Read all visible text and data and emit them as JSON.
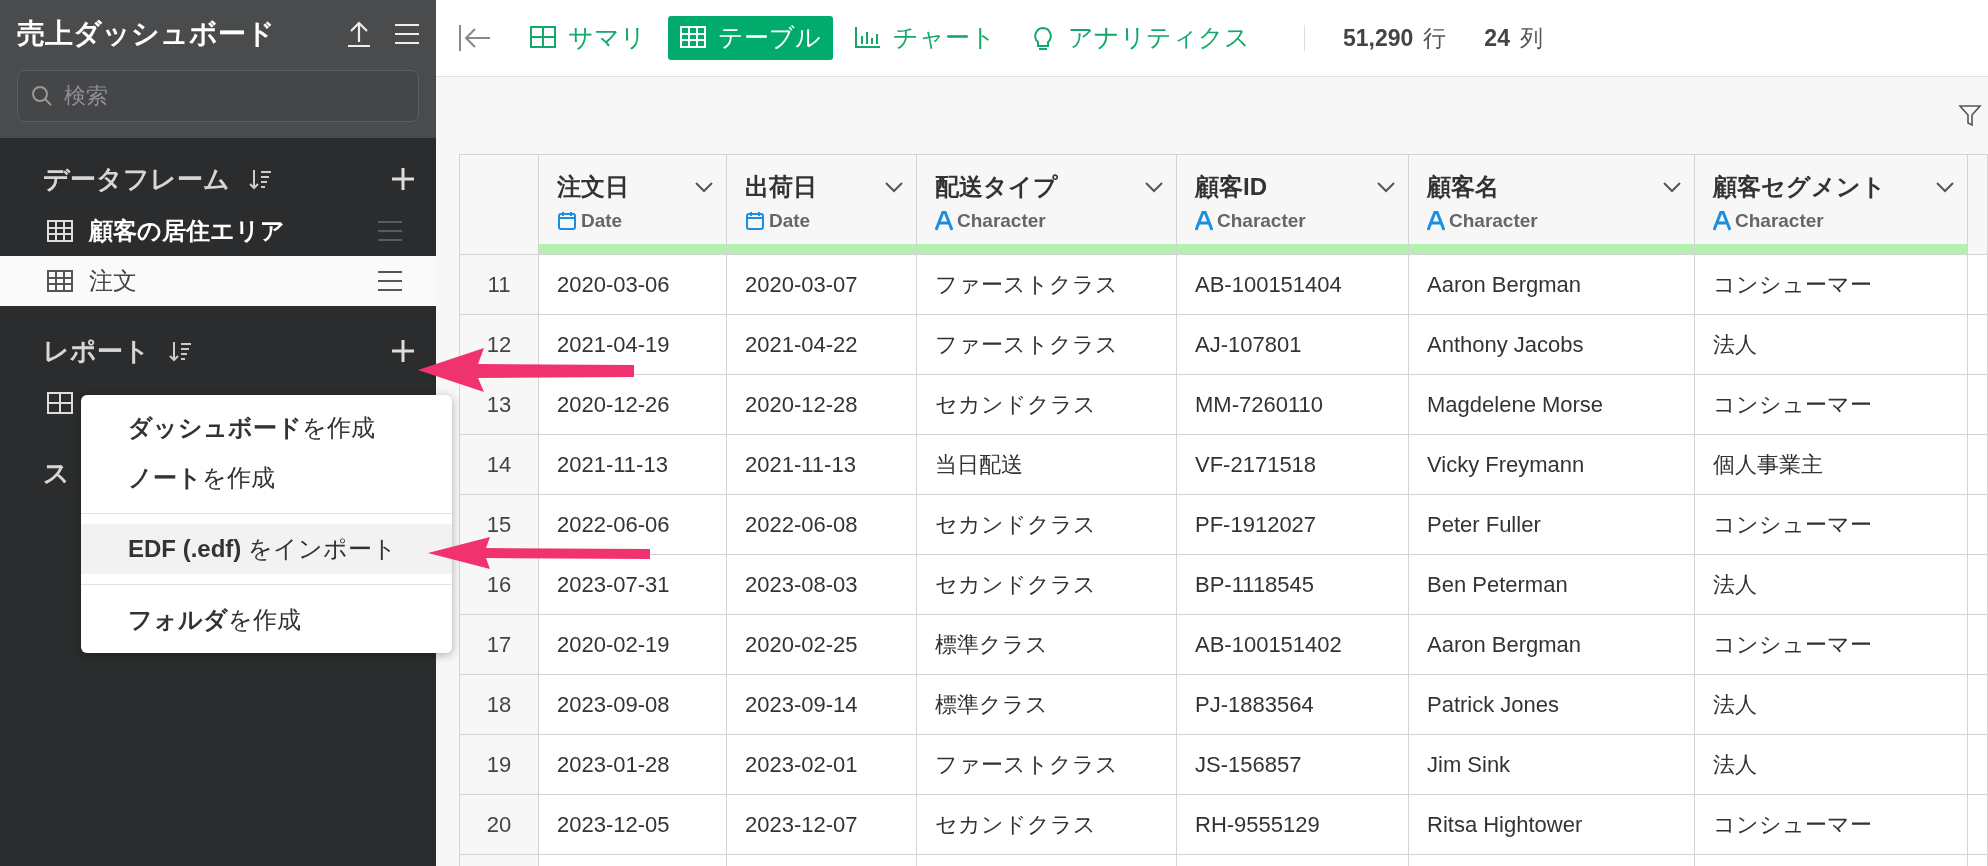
{
  "sidebar": {
    "title": "売上ダッシュボード",
    "search": {
      "placeholder": "検索"
    },
    "sections": [
      {
        "title": "データフレーム",
        "items": [
          {
            "label": "顧客の居住エリア",
            "selected": false
          },
          {
            "label": "注文",
            "selected": true
          }
        ]
      },
      {
        "title": "レポート",
        "items": [
          {
            "selected": false
          }
        ]
      },
      {
        "title": "ス"
      }
    ]
  },
  "menu": {
    "groups": [
      [
        {
          "label": "**ダッシュボード**を作成",
          "highlighted": false
        },
        {
          "label": "**ノート**を作成",
          "highlighted": false
        }
      ],
      [
        {
          "label": "**EDF (.edf)** をインポート",
          "highlighted": true
        }
      ],
      [
        {
          "label": "**フォルダ**を作成",
          "highlighted": false
        }
      ]
    ]
  },
  "toolbar": {
    "tabs": [
      {
        "kind": "summary",
        "label": "サマリ",
        "selected": false
      },
      {
        "kind": "table",
        "label": "テーブル",
        "selected": true
      },
      {
        "kind": "chart",
        "label": "チャート",
        "selected": false
      },
      {
        "kind": "analytics",
        "label": "アナリティクス",
        "selected": false
      }
    ],
    "rows_count": "51,290",
    "rows_unit": "行",
    "cols_count": "24",
    "cols_unit": "列"
  },
  "table": {
    "columns": [
      {
        "name": "注文日",
        "kind": "date",
        "type": "Date"
      },
      {
        "name": "出荷日",
        "kind": "date",
        "type": "Date"
      },
      {
        "name": "配送タイプ",
        "kind": "character",
        "type": "Character"
      },
      {
        "name": "顧客ID",
        "kind": "character",
        "type": "Character"
      },
      {
        "name": "顧客名",
        "kind": "character",
        "type": "Character"
      },
      {
        "name": "顧客セグメント",
        "kind": "character",
        "type": "Character"
      }
    ],
    "rows": [
      {
        "index": "11",
        "cells": [
          "2020-03-06",
          "2020-03-07",
          "ファーストクラス",
          "AB-100151404",
          "Aaron Bergman",
          "コンシューマー"
        ]
      },
      {
        "index": "12",
        "cells": [
          "2021-04-19",
          "2021-04-22",
          "ファーストクラス",
          "AJ-107801",
          "Anthony Jacobs",
          "法人"
        ]
      },
      {
        "index": "13",
        "cells": [
          "2020-12-26",
          "2020-12-28",
          "セカンドクラス",
          "MM-7260110",
          "Magdelene Morse",
          "コンシューマー"
        ]
      },
      {
        "index": "14",
        "cells": [
          "2021-11-13",
          "2021-11-13",
          "当日配送",
          "VF-2171518",
          "Vicky Freymann",
          "個人事業主"
        ]
      },
      {
        "index": "15",
        "cells": [
          "2022-06-06",
          "2022-06-08",
          "セカンドクラス",
          "PF-1912027",
          "Peter Fuller",
          "コンシューマー"
        ]
      },
      {
        "index": "16",
        "cells": [
          "2023-07-31",
          "2023-08-03",
          "セカンドクラス",
          "BP-1118545",
          "Ben Peterman",
          "法人"
        ]
      },
      {
        "index": "17",
        "cells": [
          "2020-02-19",
          "2020-02-25",
          "標準クラス",
          "AB-100151402",
          "Aaron Bergman",
          "コンシューマー"
        ]
      },
      {
        "index": "18",
        "cells": [
          "2023-09-08",
          "2023-09-14",
          "標準クラス",
          "PJ-1883564",
          "Patrick Jones",
          "法人"
        ]
      },
      {
        "index": "19",
        "cells": [
          "2023-01-28",
          "2023-02-01",
          "ファーストクラス",
          "JS-156857",
          "Jim Sink",
          "法人"
        ]
      },
      {
        "index": "20",
        "cells": [
          "2023-12-05",
          "2023-12-07",
          "セカンドクラス",
          "RH-9555129",
          "Ritsa Hightower",
          "コンシューマー"
        ]
      }
    ]
  }
}
